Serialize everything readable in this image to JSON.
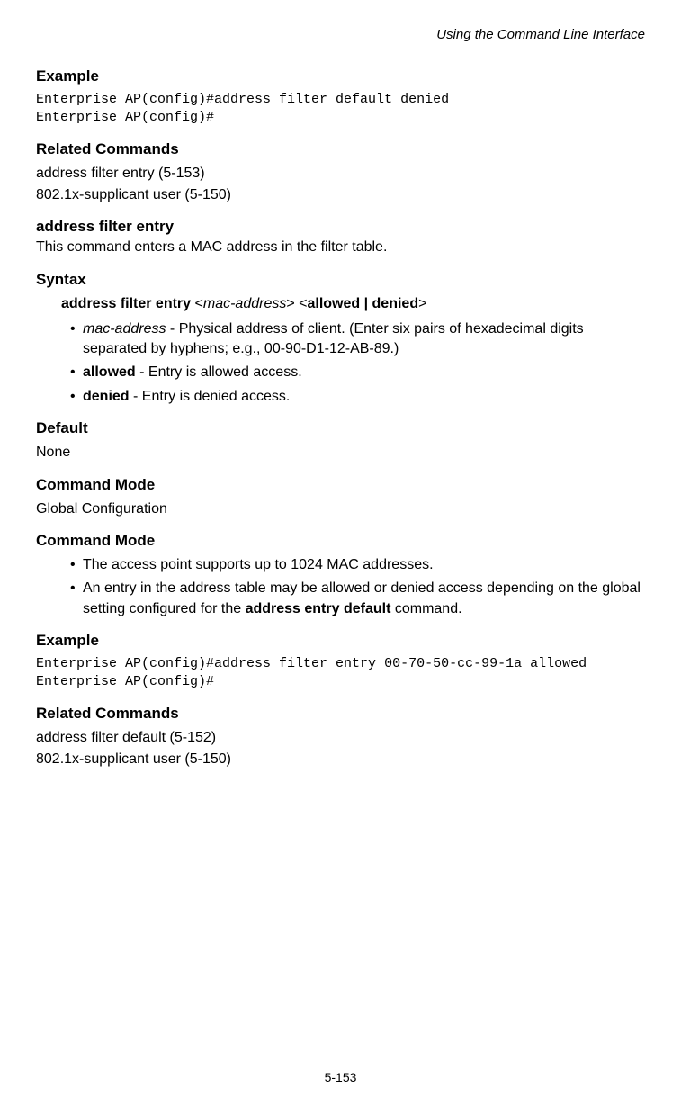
{
  "running_head": "Using the Command Line Interface",
  "sec1": {
    "example_h": "Example",
    "code": "Enterprise AP(config)#address filter default denied\nEnterprise AP(config)#",
    "related_h": "Related Commands",
    "related1": "address filter entry (5-153)",
    "related2": "802.1x-supplicant user (5-150)"
  },
  "cmd": {
    "name": "address filter entry",
    "desc": "This command enters a MAC address in the filter table.",
    "syntax_h": "Syntax",
    "syntax_bold1": "address filter entry",
    "syntax_ital1": "mac-address",
    "syntax_bold2": "allowed | denied",
    "b1_ital": "mac-address",
    "b1_rest": " - Physical address of client. (Enter six pairs of hexadecimal digits separated by hyphens; e.g., 00-90-D1-12-AB-89.)",
    "b2_bold": "allowed",
    "b2_rest": " - Entry is allowed access.",
    "b3_bold": "denied",
    "b3_rest": " - Entry is denied access.",
    "default_h": "Default",
    "default_v": "None",
    "mode_h": "Command Mode",
    "mode_v": "Global Configuration",
    "mode2_h": "Command Mode",
    "mode2_b1": "The access point supports up to 1024 MAC addresses.",
    "mode2_b2_a": "An entry in the address table may be allowed or denied access depending on the global setting configured for the ",
    "mode2_b2_bold": "address entry default",
    "mode2_b2_b": " command.",
    "example_h": "Example",
    "code": "Enterprise AP(config)#address filter entry 00-70-50-cc-99-1a allowed\nEnterprise AP(config)#",
    "related_h": "Related Commands",
    "related1": "address filter default (5-152)",
    "related2": "802.1x-supplicant user (5-150)"
  },
  "footer": "5-153"
}
